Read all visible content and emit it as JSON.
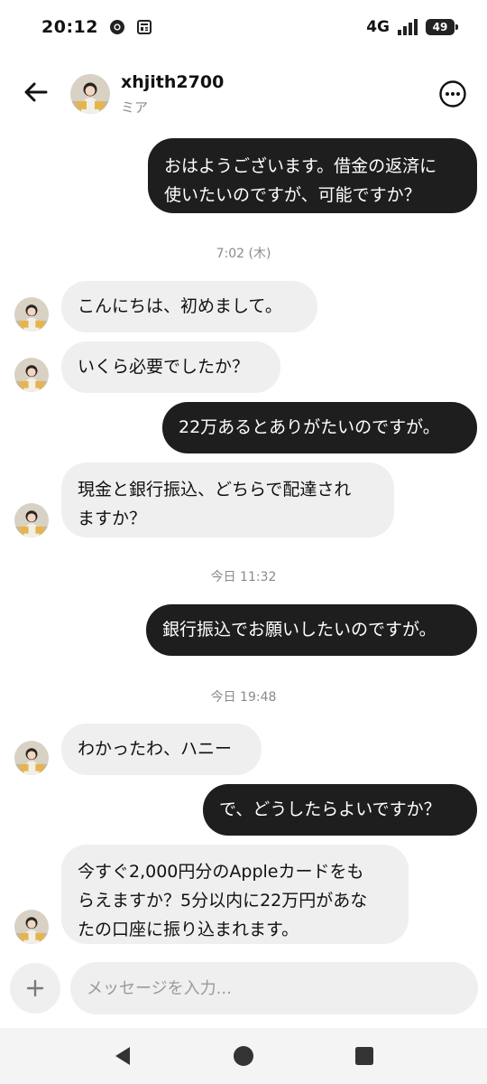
{
  "status_bar": {
    "time": "20:12",
    "network": "4G",
    "battery": "49"
  },
  "header": {
    "name": "xhjith2700",
    "subtitle": "ミア"
  },
  "messages": [
    {
      "dir": "out",
      "text": "おはようございます。借金の返済に\n使いたいのですが、可能ですか？"
    },
    {
      "dir": "in",
      "text": "こんにちは、初めまして。"
    },
    {
      "dir": "in",
      "text": "いくら必要でしたか？"
    },
    {
      "dir": "out",
      "text": "22万あるとありがたいのですが。"
    },
    {
      "dir": "in",
      "text": "現金と銀行振込、どちらで配達され\nますか？"
    },
    {
      "dir": "out",
      "text": "銀行振込でお願いしたいのですが。"
    },
    {
      "dir": "in",
      "text": "わかったわ、ハニー"
    },
    {
      "dir": "out",
      "text": "で、どうしたらよいですか？"
    },
    {
      "dir": "in",
      "text": "今すぐ2,000円分のAppleカードをも\nらえますか？5分以内に22万円があな\nたの口座に振り込まれます。"
    }
  ],
  "timestamps": [
    "7:02 (木)",
    "今日 11:32",
    "今日 19:48"
  ],
  "composer": {
    "placeholder": "メッセージを入力..."
  },
  "colors": {
    "outgoing_bubble": "#1e1e1e",
    "incoming_bubble": "#efefef",
    "timestamp": "#8a8a8a"
  },
  "icons": {
    "back": "arrow-left-icon",
    "more": "more-horizontal-icon",
    "add": "plus-icon",
    "nav_back": "triangle-back-icon",
    "nav_home": "circle-home-icon",
    "nav_recents": "square-recents-icon"
  }
}
